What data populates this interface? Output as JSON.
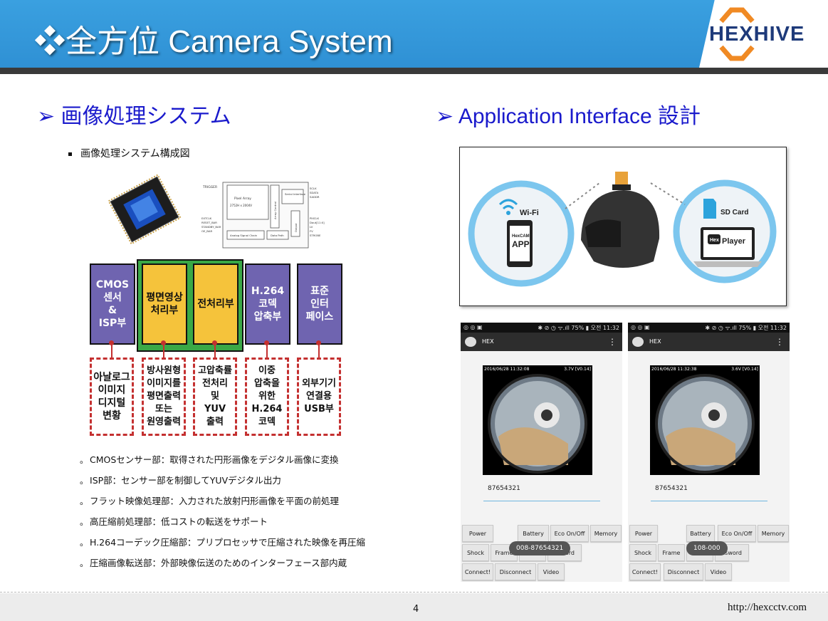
{
  "header": {
    "title": "❖全方位 Camera System",
    "logo_text": "HEXHIVE",
    "colors": {
      "header_blue": "#2e8fd3",
      "logo_orange": "#f08a24",
      "logo_navy": "#1e3a7a"
    }
  },
  "left": {
    "heading": "➢ 画像処理システム",
    "bullet": "画像処理システム構成図",
    "schematic_labels": [
      "TRIGGER",
      "Pixel Array",
      "2752H x 2004V",
      "Array Control",
      "Serial Interface",
      "SCLK",
      "SDATA",
      "SADDR",
      "EXTCLK",
      "RESET_BAR",
      "STANDBY_BAR",
      "OE_BAR",
      "PIXCLK",
      "Dout[11:0]",
      "LV",
      "FV",
      "STROBE",
      "Output",
      "Analog Signal Chain",
      "Data Path"
    ],
    "blocks": [
      {
        "label": "CMOS\n센서\n&\nISP부",
        "style": "purple"
      },
      {
        "label": "평면영상\n처리부",
        "style": "yellow"
      },
      {
        "label": "전처리부",
        "style": "yellow"
      },
      {
        "label": "H.264\n코덱\n압축부",
        "style": "purple"
      },
      {
        "label": "표준\n인터\n페이스",
        "style": "purple"
      }
    ],
    "sub_blocks": [
      "아날로그\n이미지\n디지털\n변황",
      "방사원형\n이미지를\n평면출력\n또는\n원영출력",
      "고압축률\n전처리\n및\nYUV\n출력",
      "이중\n압축을\n위한\nH.264\n코덱",
      "외부기기\n연결용\nUSB부"
    ],
    "notes": [
      "CMOSセンサー部：取得された円形画像をデジタル画像に変換",
      "ISP部：センサー部を制御してYUVデジタル出力",
      "フラット映像処理部：入力された放射円形画像を平面の前処理",
      "高圧縮前処理部：低コストの転送をサポート",
      "H.264コーデック圧縮部：プリプロセッサで圧縮された映像を再圧縮",
      "圧縮画像転送部：外部映像伝送のためのインターフェース部内蔵"
    ],
    "note_marker": "。"
  },
  "right": {
    "heading": "➢ Application Interface 設計",
    "diagram": {
      "wifi_label": "Wi-Fi",
      "app_brand": "HexCAM",
      "app_label": "APP",
      "sd_label": "SD Card",
      "player_brand": "Hex",
      "player_label": "Player"
    },
    "phones": [
      {
        "status_left": "◎ ◎ ▣",
        "status_right": "✱ ⊘ ◷ ᯤ.ıll 75% ▮ 오전 11:32",
        "app_title": "HEX",
        "overlay_left": "2016/06/28 11:32:08",
        "overlay_right": "3.7V [V0.14]",
        "input_value": "87654321",
        "toast": "008-87654321",
        "buttons": [
          "Power",
          "Battery",
          "Eco On/Off",
          "Memory",
          "Shock",
          "Frame",
          "",
          "ssword",
          "Connect!",
          "Disconnect",
          "Video"
        ]
      },
      {
        "status_left": "◎ ◎ ▣",
        "status_right": "✱ ⊘ ◷ ᯤ.ıll 75% ▮ 오전 11:32",
        "app_title": "HEX",
        "overlay_left": "2016/06/28 11:32:38",
        "overlay_right": "3.6V [V0.14]",
        "input_value": "87654321",
        "toast": "108-000",
        "buttons": [
          "Power",
          "Battery",
          "Eco On/Off",
          "Memory",
          "Shock",
          "Frame",
          "",
          "ssword",
          "Connect!",
          "Disconnect",
          "Video"
        ]
      }
    ]
  },
  "footer": {
    "page_number": "4",
    "url": "http://hexcctv.com"
  }
}
